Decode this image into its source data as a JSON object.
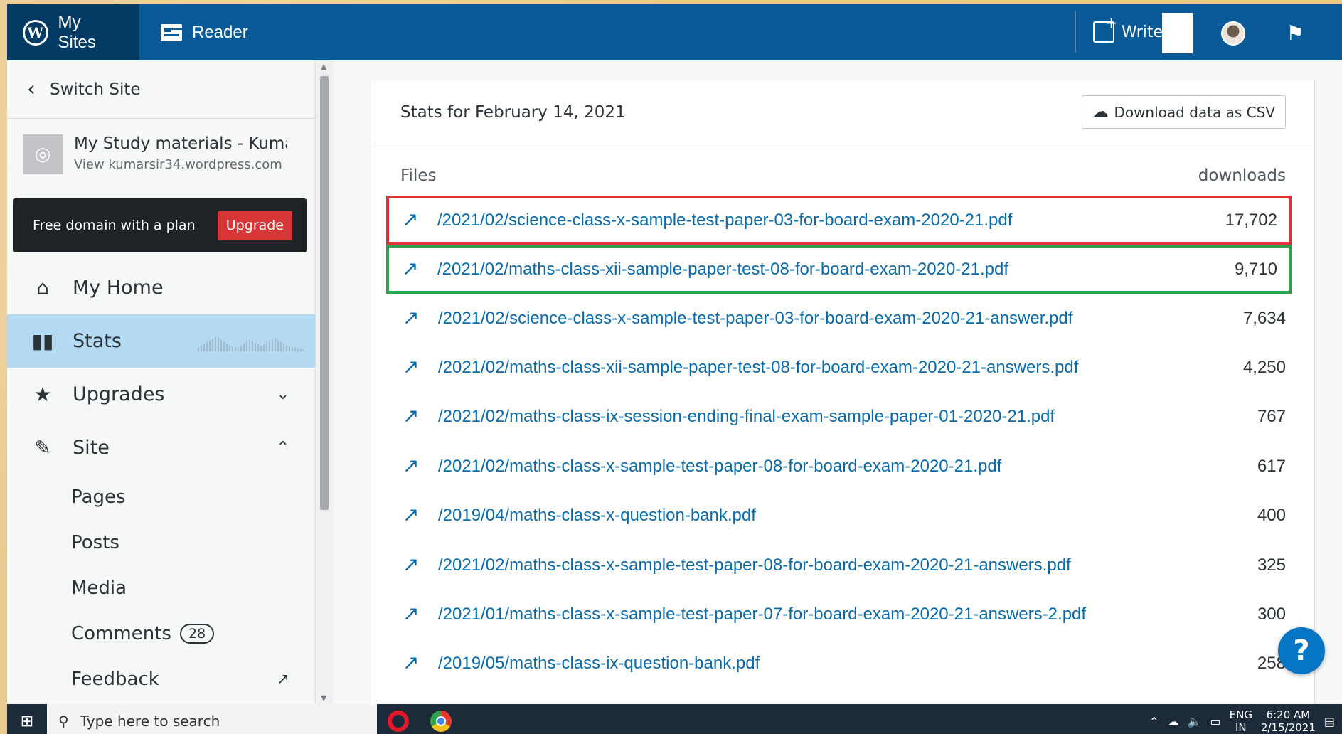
{
  "masterbar": {
    "my_sites": "My Sites",
    "reader": "Reader",
    "write": "Write"
  },
  "sidebar": {
    "switch_site": "Switch Site",
    "site_title": "My Study materials - Kumar",
    "site_url": "View kumarsir34.wordpress.com",
    "upsell_text": "Free domain with a plan",
    "upgrade_label": "Upgrade",
    "items": [
      {
        "label": "My Home",
        "icon": "home-icon"
      },
      {
        "label": "Stats",
        "icon": "bar-chart-icon",
        "active": true
      },
      {
        "label": "Upgrades",
        "icon": "star-icon",
        "arrow": "chevron-down-icon"
      },
      {
        "label": "Site",
        "icon": "pencil-icon",
        "arrow": "chevron-up-icon"
      }
    ],
    "sub_items": [
      {
        "label": "Pages"
      },
      {
        "label": "Posts"
      },
      {
        "label": "Media"
      },
      {
        "label": "Comments",
        "badge": "28"
      },
      {
        "label": "Feedback",
        "icon": "external-link-icon"
      }
    ]
  },
  "stats": {
    "title": "Stats for February 14, 2021",
    "csv_button": "Download data as CSV",
    "col_files": "Files",
    "col_downloads": "downloads",
    "rows": [
      {
        "file": "/2021/02/science-class-x-sample-test-paper-03-for-board-exam-2020-21.pdf",
        "downloads": "17,702",
        "highlight": "red"
      },
      {
        "file": "/2021/02/maths-class-xii-sample-paper-test-08-for-board-exam-2020-21.pdf",
        "downloads": "9,710",
        "highlight": "green"
      },
      {
        "file": "/2021/02/science-class-x-sample-test-paper-03-for-board-exam-2020-21-answer.pdf",
        "downloads": "7,634"
      },
      {
        "file": "/2021/02/maths-class-xii-sample-paper-test-08-for-board-exam-2020-21-answers.pdf",
        "downloads": "4,250"
      },
      {
        "file": "/2021/02/maths-class-ix-session-ending-final-exam-sample-paper-01-2020-21.pdf",
        "downloads": "767"
      },
      {
        "file": "/2021/02/maths-class-x-sample-test-paper-08-for-board-exam-2020-21.pdf",
        "downloads": "617"
      },
      {
        "file": "/2019/04/maths-class-x-question-bank.pdf",
        "downloads": "400"
      },
      {
        "file": "/2021/02/maths-class-x-sample-test-paper-08-for-board-exam-2020-21-answers.pdf",
        "downloads": "325"
      },
      {
        "file": "/2021/01/maths-class-x-sample-test-paper-07-for-board-exam-2020-21-answers-2.pdf",
        "downloads": "300"
      },
      {
        "file": "/2019/05/maths-class-ix-question-bank.pdf",
        "downloads": "258"
      }
    ]
  },
  "help": "?",
  "taskbar": {
    "search_placeholder": "Type here to search",
    "lang_top": "ENG",
    "lang_bottom": "IN",
    "time": "6:20 AM",
    "date": "2/15/2021"
  },
  "colors": {
    "masterbar": "#0a5a97",
    "active_item": "#b4d9f3",
    "link": "#0b6ba8",
    "upgrade": "#d63638",
    "highlight_red": "#e0303a",
    "highlight_green": "#2ca24a"
  }
}
